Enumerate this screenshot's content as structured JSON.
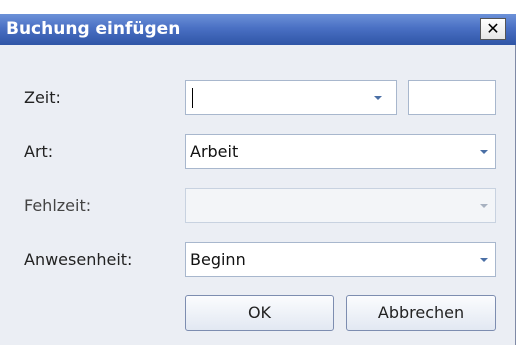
{
  "dialog": {
    "title": "Buchung einfügen",
    "close_symbol": "✕"
  },
  "fields": {
    "zeit": {
      "label": "Zeit:",
      "value": ""
    },
    "art": {
      "label": "Art:",
      "value": "Arbeit"
    },
    "fehlzeit": {
      "label": "Fehlzeit:",
      "value": "",
      "disabled": true
    },
    "anwesenheit": {
      "label": "Anwesenheit:",
      "value": "Beginn"
    }
  },
  "buttons": {
    "ok": "OK",
    "cancel": "Abbrechen"
  },
  "colors": {
    "titlebar": "#4a70c4",
    "dialog_bg": "#ebeef4",
    "input_border": "#a8b7cd",
    "dropdown_arrow": "#4a6fa5"
  },
  "icons": {
    "close": "close-icon",
    "dropdown": "chevron-down-icon"
  }
}
